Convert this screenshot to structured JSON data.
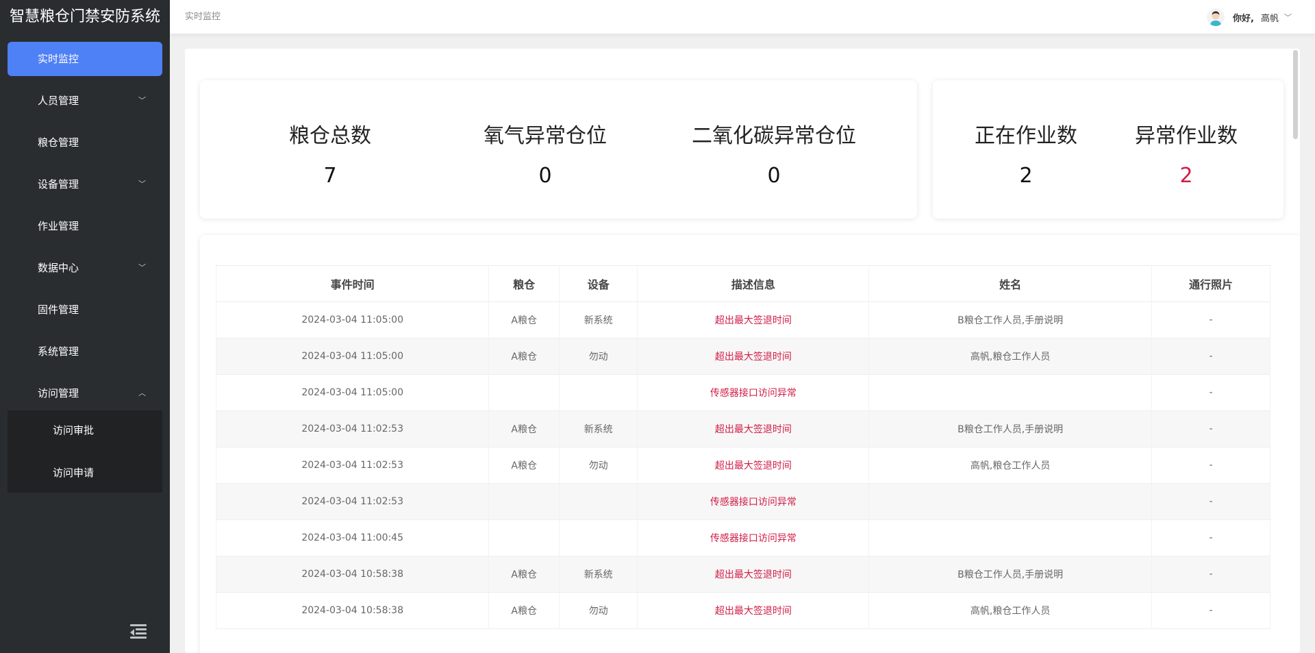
{
  "sidebar": {
    "title": "智慧粮仓门禁安防系统",
    "items": [
      {
        "label": "实时监控",
        "active": true,
        "chevron": ""
      },
      {
        "label": "人员管理",
        "active": false,
        "chevron": "﹀"
      },
      {
        "label": "粮仓管理",
        "active": false,
        "chevron": ""
      },
      {
        "label": "设备管理",
        "active": false,
        "chevron": "﹀"
      },
      {
        "label": "作业管理",
        "active": false,
        "chevron": ""
      },
      {
        "label": "数据中心",
        "active": false,
        "chevron": "﹀"
      },
      {
        "label": "固件管理",
        "active": false,
        "chevron": ""
      },
      {
        "label": "系统管理",
        "active": false,
        "chevron": ""
      },
      {
        "label": "访问管理",
        "active": false,
        "chevron": "︿"
      }
    ],
    "submenu": [
      {
        "label": "访问审批"
      },
      {
        "label": "访问申请"
      }
    ]
  },
  "header": {
    "breadcrumb": "实时监控",
    "greeting": "你好,",
    "username": "高帆"
  },
  "stats": {
    "total_granaries": {
      "label": "粮仓总数",
      "value": "7"
    },
    "oxygen_abnormal": {
      "label": "氧气异常仓位",
      "value": "0"
    },
    "co2_abnormal": {
      "label": "二氧化碳异常仓位",
      "value": "0"
    },
    "working": {
      "label": "正在作业数",
      "value": "2"
    },
    "abnormal_work": {
      "label": "异常作业数",
      "value": "2"
    }
  },
  "table": {
    "columns": [
      "事件时间",
      "粮仓",
      "设备",
      "描述信息",
      "姓名",
      "通行照片"
    ],
    "rows": [
      [
        "2024-03-04 11:05:00",
        "A粮仓",
        "新系统",
        "超出最大签退时间",
        "B粮仓工作人员,手册说明",
        "-"
      ],
      [
        "2024-03-04 11:05:00",
        "A粮仓",
        "勿动",
        "超出最大签退时间",
        "高帆,粮仓工作人员",
        "-"
      ],
      [
        "2024-03-04 11:05:00",
        "",
        "",
        "传感器接口访问异常",
        "",
        "-"
      ],
      [
        "2024-03-04 11:02:53",
        "A粮仓",
        "新系统",
        "超出最大签退时间",
        "B粮仓工作人员,手册说明",
        "-"
      ],
      [
        "2024-03-04 11:02:53",
        "A粮仓",
        "勿动",
        "超出最大签退时间",
        "高帆,粮仓工作人员",
        "-"
      ],
      [
        "2024-03-04 11:02:53",
        "",
        "",
        "传感器接口访问异常",
        "",
        "-"
      ],
      [
        "2024-03-04 11:00:45",
        "",
        "",
        "传感器接口访问异常",
        "",
        "-"
      ],
      [
        "2024-03-04 10:58:38",
        "A粮仓",
        "新系统",
        "超出最大签退时间",
        "B粮仓工作人员,手册说明",
        "-"
      ],
      [
        "2024-03-04 10:58:38",
        "A粮仓",
        "勿动",
        "超出最大签退时间",
        "高帆,粮仓工作人员",
        "-"
      ]
    ]
  },
  "colors": {
    "accent": "#4e80f6",
    "sidebar_bg": "#2a2d30",
    "alert": "#d01d47"
  }
}
